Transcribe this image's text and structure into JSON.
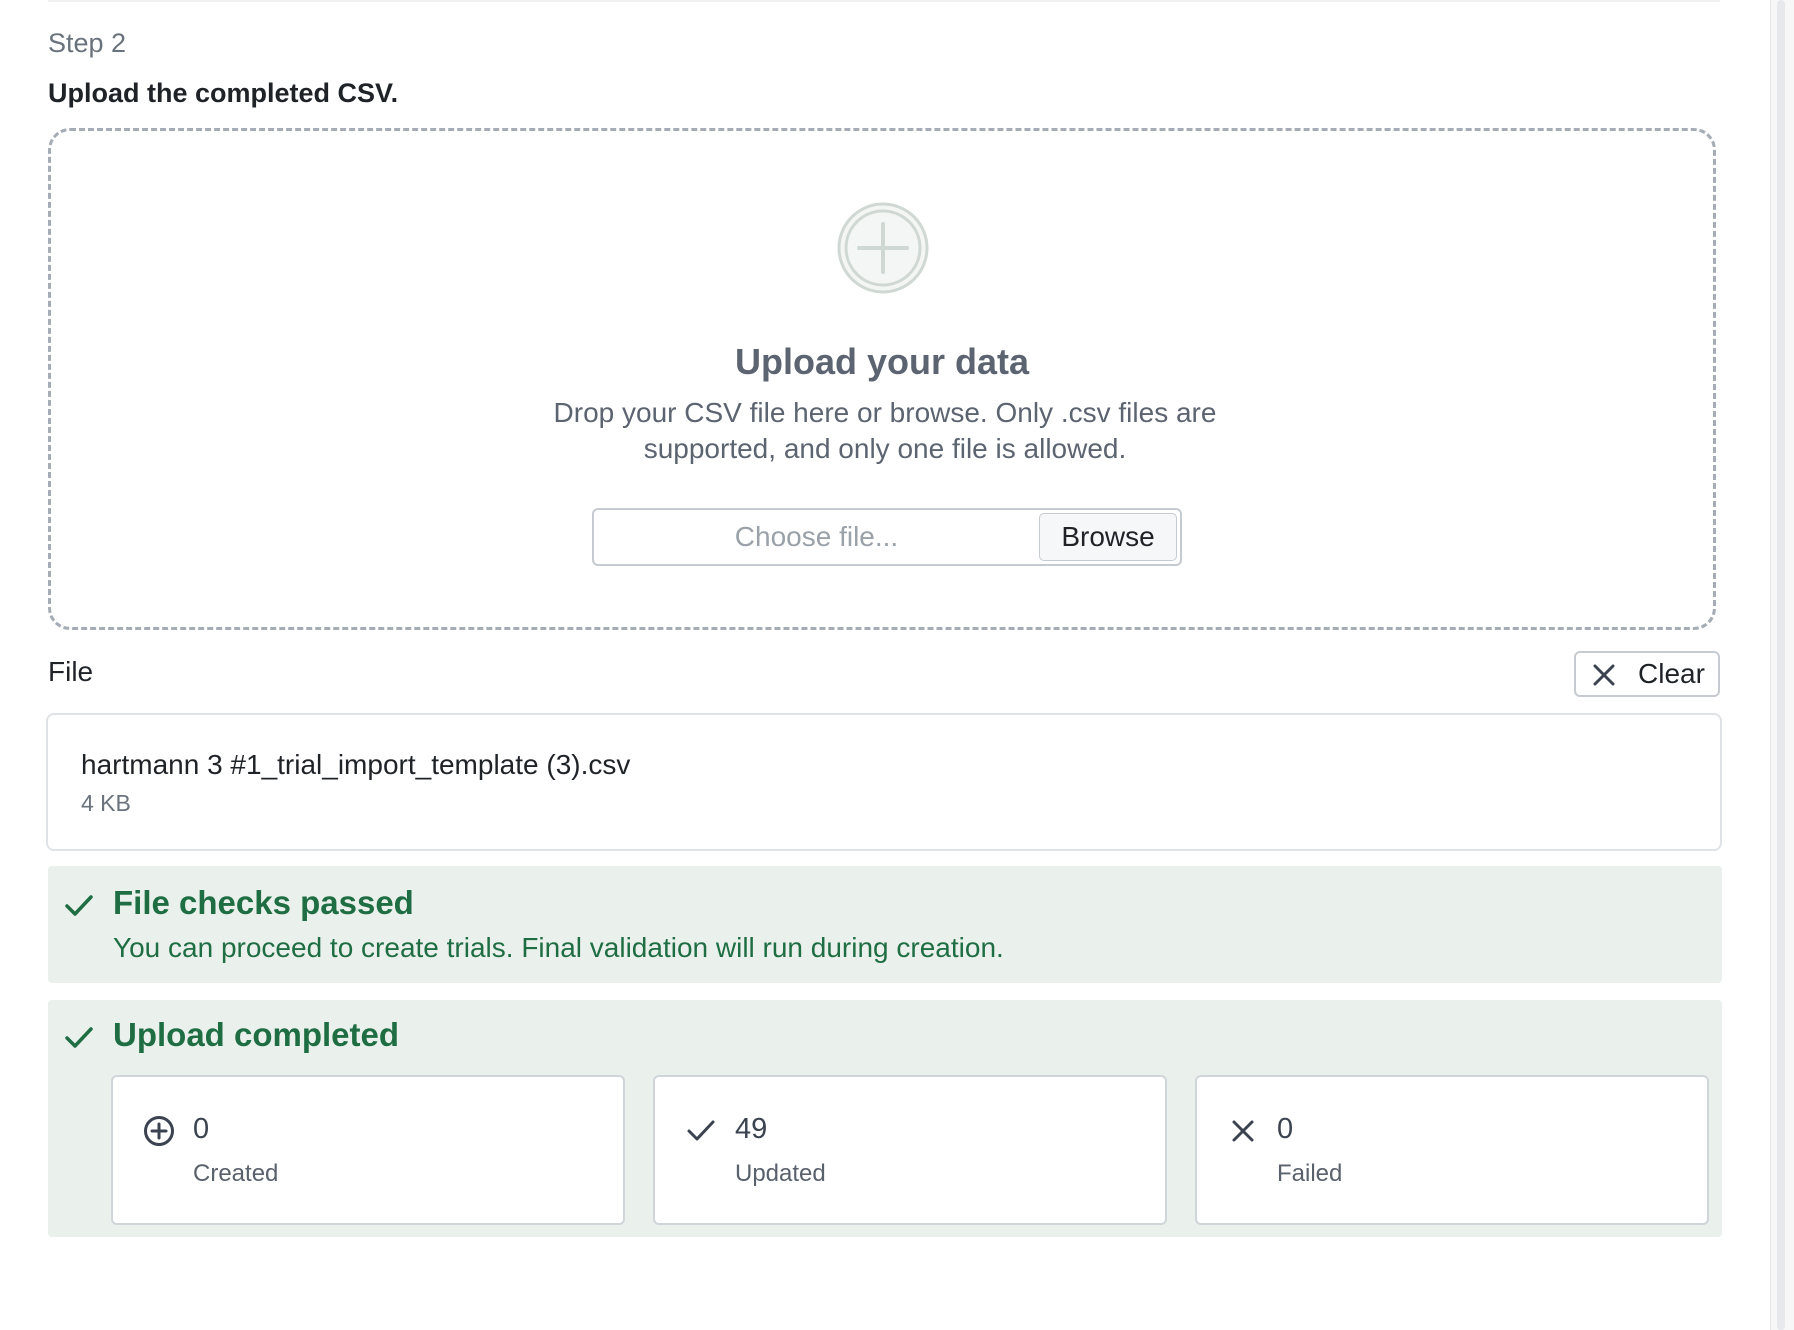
{
  "step": {
    "label": "Step 2",
    "heading": "Upload the completed CSV."
  },
  "dropzone": {
    "icon": "plus-circle-icon",
    "title": "Upload your data",
    "description": "Drop your CSV file here or browse. Only .csv files are supported, and only one file is allowed.",
    "file_input_placeholder": "Choose file...",
    "browse_label": "Browse"
  },
  "file_section": {
    "label": "File",
    "clear_label": "Clear",
    "file_name": "hartmann 3 #1_trial_import_template (3).csv",
    "file_size": "4 KB"
  },
  "checks_banner": {
    "title": "File checks passed",
    "description": "You can proceed to create trials. Final validation will run during creation."
  },
  "upload_banner": {
    "title": "Upload completed",
    "stats": [
      {
        "icon": "plus-circle-icon",
        "value": "0",
        "label": "Created"
      },
      {
        "icon": "check-icon",
        "value": "49",
        "label": "Updated"
      },
      {
        "icon": "x-icon",
        "value": "0",
        "label": "Failed"
      }
    ]
  },
  "colors": {
    "success_text": "#1f6e43",
    "success_bg": "#eaf1ec",
    "muted_text": "#6a737d",
    "border": "#c6cbd1"
  }
}
